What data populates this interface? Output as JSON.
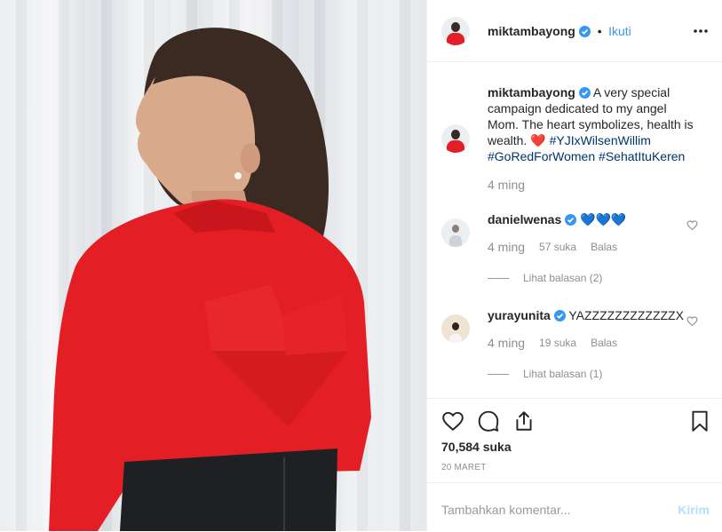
{
  "post": {
    "username": "miktambayong",
    "follow_label": "Ikuti",
    "separator": "•",
    "caption_text": "A very special campaign dedicated to my angel Mom. The heart symbolizes, health is wealth.",
    "caption_emoji": "❤️",
    "hashtags": [
      "#YJIxWilsenWillim",
      "#GoRedForWomen",
      "#SehatItuKeren"
    ],
    "caption_time": "4 ming"
  },
  "comments": [
    {
      "username": "danielwenas",
      "text": "💙💙💙",
      "time": "4 ming",
      "likes": "57 suka",
      "reply_label": "Balas",
      "view_replies": "Lihat balasan (2)"
    },
    {
      "username": "yurayunita",
      "text": "YAZZZZZZZZZZZZX",
      "time": "4 ming",
      "likes": "19 suka",
      "reply_label": "Balas",
      "view_replies": "Lihat balasan (1)"
    }
  ],
  "footer": {
    "likes_count": "70,584 suka",
    "date": "20 MARET",
    "comment_placeholder": "Tambahkan komentar...",
    "send_label": "Kirim"
  },
  "colors": {
    "link_blue": "#3897f0",
    "hashtag": "#003569",
    "shirt_red": "#e31e24",
    "muted": "#8e8e8e"
  }
}
